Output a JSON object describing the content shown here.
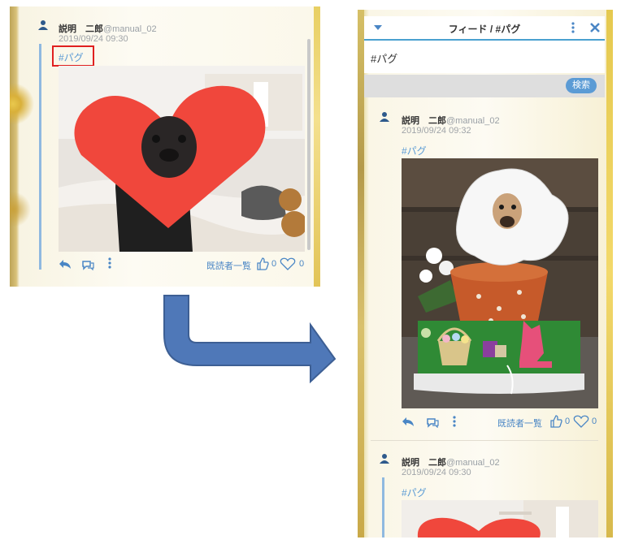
{
  "left_post": {
    "user_name": "説明　二郎",
    "handle": "@manual_02",
    "timestamp": "2019/09/24 09:30",
    "tag": "#パグ",
    "readers_label": "既読者一覧",
    "like_count": "0",
    "heart_count": "0"
  },
  "feed_panel": {
    "title": "フィード / #パグ",
    "search_value": "#パグ",
    "search_button": "検索"
  },
  "posts": [
    {
      "user_name": "説明　二郎",
      "handle": "@manual_02",
      "timestamp": "2019/09/24 09:32",
      "tag": "#パグ",
      "readers_label": "既読者一覧",
      "like_count": "0",
      "heart_count": "0"
    },
    {
      "user_name": "説明　二郎",
      "handle": "@manual_02",
      "timestamp": "2019/09/24 09:30",
      "tag": "#パグ"
    }
  ],
  "colors": {
    "accent": "#4a86c5",
    "tag": "#5b9bd5",
    "highlight_box": "#e02020",
    "arrow": "#4f78b8"
  },
  "icons": [
    "avatar-icon",
    "reply-icon",
    "comment-icon",
    "more-icon",
    "thumbs-up-icon",
    "heart-icon",
    "chevron-down-icon",
    "close-icon",
    "arrow-icon"
  ]
}
